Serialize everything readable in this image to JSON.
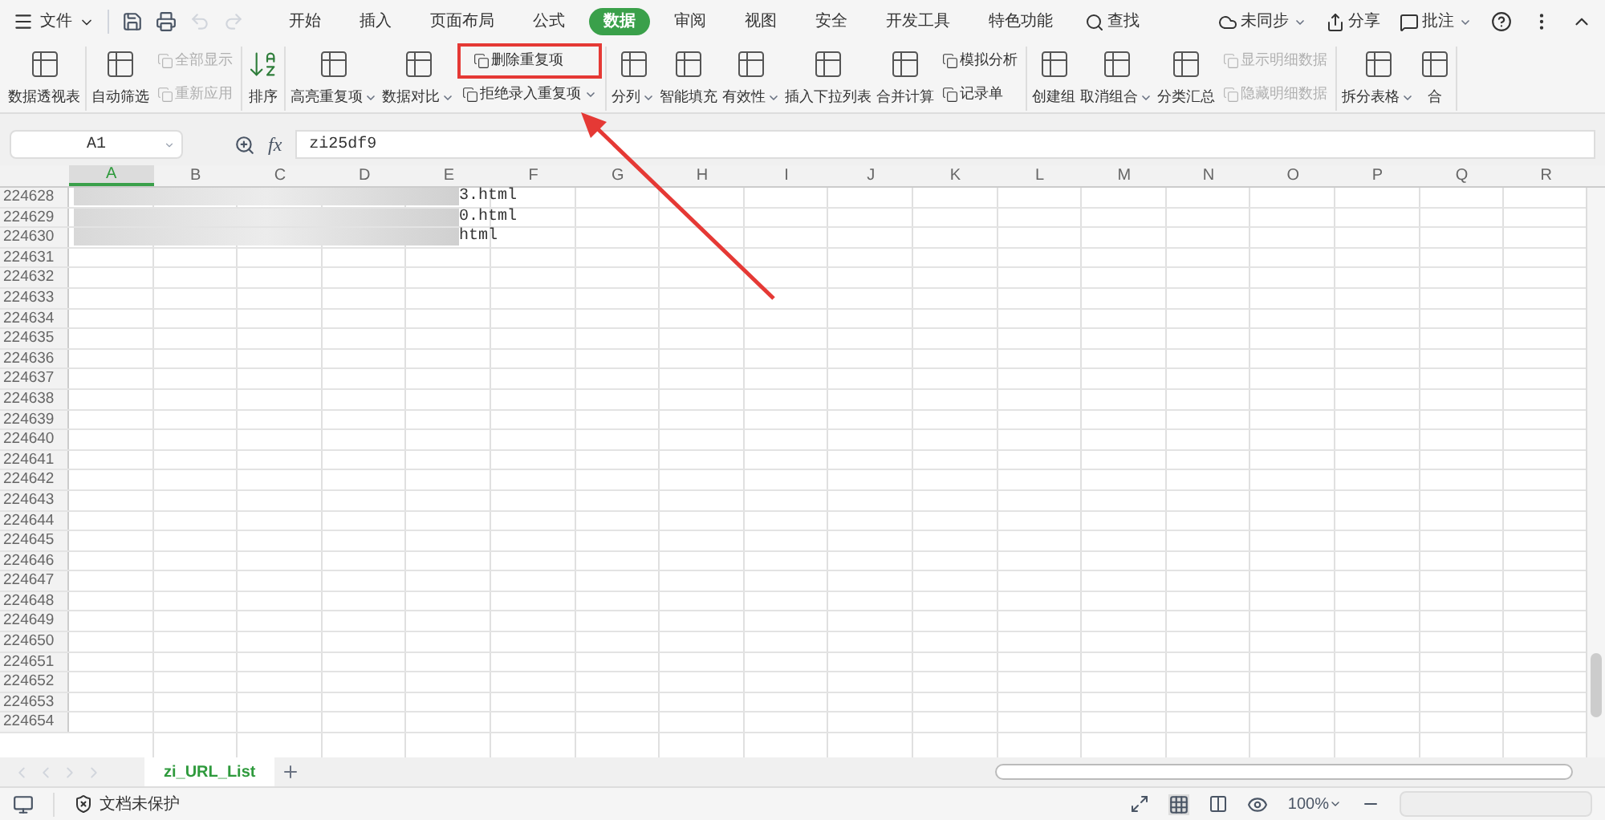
{
  "menu": {
    "file": "文件",
    "tabs": [
      {
        "label": "开始",
        "selected": false
      },
      {
        "label": "插入",
        "selected": false
      },
      {
        "label": "页面布局",
        "selected": false
      },
      {
        "label": "公式",
        "selected": false
      },
      {
        "label": "数据",
        "selected": true
      },
      {
        "label": "审阅",
        "selected": false
      },
      {
        "label": "视图",
        "selected": false
      },
      {
        "label": "安全",
        "selected": false
      },
      {
        "label": "开发工具",
        "selected": false
      },
      {
        "label": "特色功能",
        "selected": false
      }
    ],
    "search": "查找",
    "right": [
      {
        "label": "未同步",
        "dropdown": true
      },
      {
        "label": "分享",
        "dropdown": false
      },
      {
        "label": "批注",
        "dropdown": true
      }
    ]
  },
  "ribbon": [
    [
      {
        "kind": "big",
        "label": "数据透视表",
        "dropdown": false
      }
    ],
    [
      {
        "kind": "big",
        "label": "自动筛选",
        "dropdown": false
      },
      {
        "kind": "stack",
        "items": [
          {
            "label": "全部显示",
            "disabled": true,
            "highlighted": false,
            "dropdown": false
          },
          {
            "label": "重新应用",
            "disabled": true,
            "highlighted": false,
            "dropdown": false
          }
        ]
      }
    ],
    [
      {
        "kind": "sort",
        "label": "排序",
        "dropdown": false
      }
    ],
    [
      {
        "kind": "big",
        "label": "高亮重复项",
        "dropdown": true
      },
      {
        "kind": "big",
        "label": "数据对比",
        "dropdown": true
      },
      {
        "kind": "stack",
        "items": [
          {
            "label": "删除重复项",
            "disabled": false,
            "highlighted": true,
            "dropdown": false
          },
          {
            "label": "拒绝录入重复项",
            "disabled": false,
            "highlighted": false,
            "dropdown": true
          }
        ]
      }
    ],
    [
      {
        "kind": "big",
        "label": "分列",
        "dropdown": true
      },
      {
        "kind": "big",
        "label": "智能填充",
        "dropdown": false
      },
      {
        "kind": "big",
        "label": "有效性",
        "dropdown": true
      },
      {
        "kind": "big",
        "label": "插入下拉列表",
        "dropdown": false
      },
      {
        "kind": "big",
        "label": "合并计算",
        "dropdown": false
      },
      {
        "kind": "stack",
        "items": [
          {
            "label": "模拟分析",
            "disabled": false,
            "highlighted": false,
            "dropdown": false
          },
          {
            "label": "记录单",
            "disabled": false,
            "highlighted": false,
            "dropdown": false
          }
        ]
      }
    ],
    [
      {
        "kind": "big",
        "label": "创建组",
        "dropdown": false
      },
      {
        "kind": "big",
        "label": "取消组合",
        "dropdown": true
      },
      {
        "kind": "big",
        "label": "分类汇总",
        "dropdown": false
      },
      {
        "kind": "stack",
        "items": [
          {
            "label": "显示明细数据",
            "disabled": true,
            "highlighted": false,
            "dropdown": false
          },
          {
            "label": "隐藏明细数据",
            "disabled": true,
            "highlighted": false,
            "dropdown": false
          }
        ]
      }
    ],
    [
      {
        "kind": "big",
        "label": "拆分表格",
        "dropdown": true
      },
      {
        "kind": "big",
        "label": "合",
        "dropdown": false
      }
    ]
  ],
  "formula_bar": {
    "cell": "A1",
    "fx": "fx",
    "value": "zi25df9"
  },
  "columns": [
    {
      "label": "A",
      "selected": true
    },
    {
      "label": "B",
      "selected": false
    },
    {
      "label": "C",
      "selected": false
    },
    {
      "label": "D",
      "selected": false
    },
    {
      "label": "E",
      "selected": false
    },
    {
      "label": "F",
      "selected": false
    },
    {
      "label": "G",
      "selected": false
    },
    {
      "label": "H",
      "selected": false
    },
    {
      "label": "I",
      "selected": false
    },
    {
      "label": "J",
      "selected": false
    },
    {
      "label": "K",
      "selected": false
    },
    {
      "label": "L",
      "selected": false
    },
    {
      "label": "M",
      "selected": false
    },
    {
      "label": "N",
      "selected": false
    },
    {
      "label": "O",
      "selected": false
    },
    {
      "label": "P",
      "selected": false
    },
    {
      "label": "Q",
      "selected": false
    },
    {
      "label": "R",
      "selected": false
    }
  ],
  "rows": [
    {
      "num": "224628",
      "visible_text": "3.html",
      "blurred": true
    },
    {
      "num": "224629",
      "visible_text": "0.html",
      "blurred": true
    },
    {
      "num": "224630",
      "visible_text": "html",
      "blurred": true
    },
    {
      "num": "224631"
    },
    {
      "num": "224632"
    },
    {
      "num": "224633"
    },
    {
      "num": "224634"
    },
    {
      "num": "224635"
    },
    {
      "num": "224636"
    },
    {
      "num": "224637"
    },
    {
      "num": "224638"
    },
    {
      "num": "224639"
    },
    {
      "num": "224640"
    },
    {
      "num": "224641"
    },
    {
      "num": "224642"
    },
    {
      "num": "224643"
    },
    {
      "num": "224644"
    },
    {
      "num": "224645"
    },
    {
      "num": "224646"
    },
    {
      "num": "224647"
    },
    {
      "num": "224648"
    },
    {
      "num": "224649"
    },
    {
      "num": "224650"
    },
    {
      "num": "224651"
    },
    {
      "num": "224652"
    },
    {
      "num": "224653"
    },
    {
      "num": "224654"
    }
  ],
  "sheets": [
    {
      "label": "zi_URL_List",
      "selected": true
    }
  ],
  "status_bar": {
    "protection": "文档未保护",
    "zoom": "100%"
  }
}
